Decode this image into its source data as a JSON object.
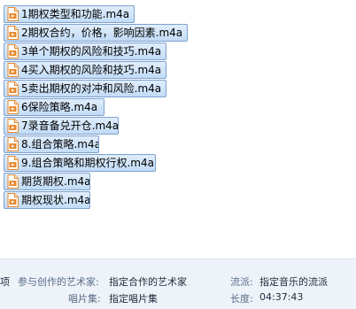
{
  "file_list": {
    "items": [
      {
        "name": "1期权类型和功能.m4a",
        "icon": "audio-file-icon"
      },
      {
        "name": "2期权合约，价格，影响因素.m4a",
        "icon": "audio-file-icon"
      },
      {
        "name": "3单个期权的风险和技巧.m4a",
        "icon": "audio-file-icon"
      },
      {
        "name": "4买入期权的风险和技巧.m4a",
        "icon": "audio-file-icon"
      },
      {
        "name": "5卖出期权的对冲和风险.m4a",
        "icon": "audio-file-icon"
      },
      {
        "name": "6保险策略.m4a",
        "icon": "audio-file-icon"
      },
      {
        "name": "7录音备兑开仓.m4a",
        "icon": "audio-file-icon"
      },
      {
        "name": "8.组合策略.m4a",
        "icon": "audio-file-icon"
      },
      {
        "name": "9.组合策略和期权行权.m4a",
        "icon": "audio-file-icon"
      },
      {
        "name": "期货期权.m4a",
        "icon": "audio-file-icon"
      },
      {
        "name": "期权现状.m4a",
        "icon": "audio-file-icon"
      }
    ]
  },
  "details_pane": {
    "count_suffix": "项",
    "contributing_artist_label": "参与创作的艺术家:",
    "contributing_artist_value": "指定合作的艺术家",
    "album_label": "唱片集:",
    "album_value": "指定唱片集",
    "genre_label": "流派:",
    "genre_value": "指定音乐的流派",
    "length_label": "长度:",
    "length_value": "04:37:43"
  },
  "colors": {
    "selection_fill": "#c9dff8",
    "selection_border": "#7da2ce",
    "icon_orange": "#e8892b",
    "details_bg": "#eef3fa"
  }
}
